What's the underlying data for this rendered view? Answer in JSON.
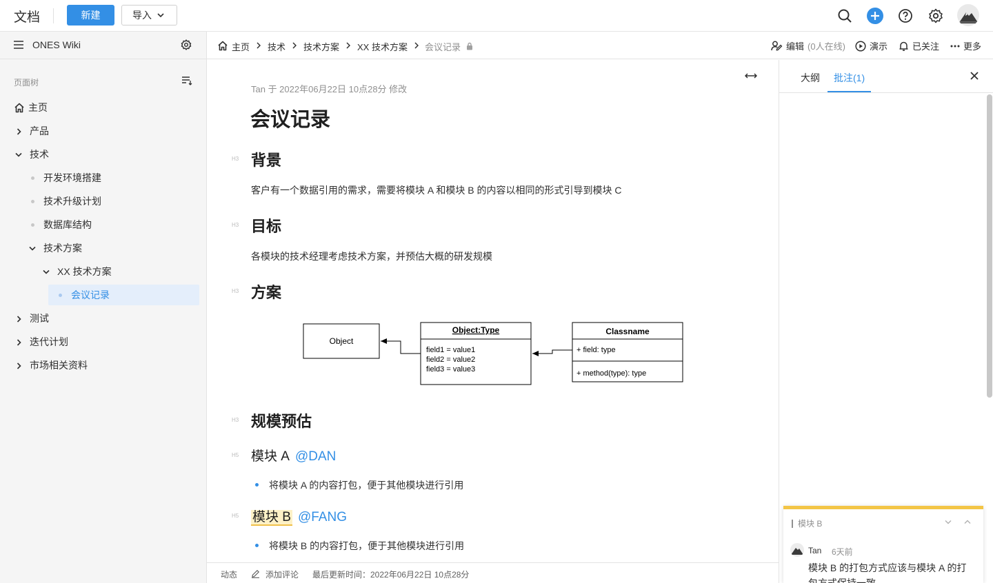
{
  "topbar": {
    "app_title": "文档",
    "new_button": "新建",
    "import_button": "导入"
  },
  "sidebar": {
    "title": "ONES Wiki",
    "tree_label": "页面树",
    "items": [
      {
        "label": "主页"
      },
      {
        "label": "产品"
      },
      {
        "label": "技术"
      },
      {
        "label": "开发环境搭建"
      },
      {
        "label": "技术升级计划"
      },
      {
        "label": "数据库结构"
      },
      {
        "label": "技术方案"
      },
      {
        "label": "XX 技术方案"
      },
      {
        "label": "会议记录"
      },
      {
        "label": "测试"
      },
      {
        "label": "迭代计划"
      },
      {
        "label": "市场相关资料"
      }
    ]
  },
  "breadcrumb": [
    "主页",
    "技术",
    "技术方案",
    "XX 技术方案",
    "会议记录"
  ],
  "actions": {
    "edit": "编辑",
    "online": "(0人在线)",
    "present": "演示",
    "follow": "已关注",
    "more": "更多"
  },
  "doc": {
    "meta": "Tan 于 2022年06月22日 10点28分 修改",
    "title": "会议记录",
    "heading_marker_h3": "H3",
    "heading_marker_h5": "H5",
    "sections": {
      "background": "背景",
      "background_text": "客户有一个数据引用的需求，需要将模块 A 和模块 B 的内容以相同的形式引导到模块 C",
      "goal": "目标",
      "goal_text": "各模块的技术经理考虑技术方案，并预估大概的研发规模",
      "plan": "方案",
      "estimate": "规模预估",
      "module_a": "模块 A",
      "module_a_mention": "@DAN",
      "module_a_item": "将模块 A 的内容打包，便于其他模块进行引用",
      "module_b": "模块 B",
      "module_b_mention": "@FANG",
      "module_b_item": "将模块 B 的内容打包，便于其他模块进行引用"
    },
    "uml": {
      "object": "Object",
      "object_type": "Object:Type",
      "fields": [
        "field1 = value1",
        "field2 = value2",
        "field3 = value3"
      ],
      "classname": "Classname",
      "field": "+ field: type",
      "method": "+ method(type): type"
    }
  },
  "status": {
    "activity": "动态",
    "add_comment": "添加评论",
    "last_updated": "最后更新时间：2022年06月22日 10点28分"
  },
  "right_panel": {
    "tab_outline": "大纲",
    "tab_comments": "批注(1)",
    "comment": {
      "reference": "模块 B",
      "author": "Tan",
      "time": "6天前",
      "text": "模块 B 的打包方式应该与模块 A 的打包方式保持一致"
    }
  },
  "colors": {
    "accent": "#338fe5",
    "highlight": "#fdf1c6",
    "comment_bar": "#f3c547"
  }
}
